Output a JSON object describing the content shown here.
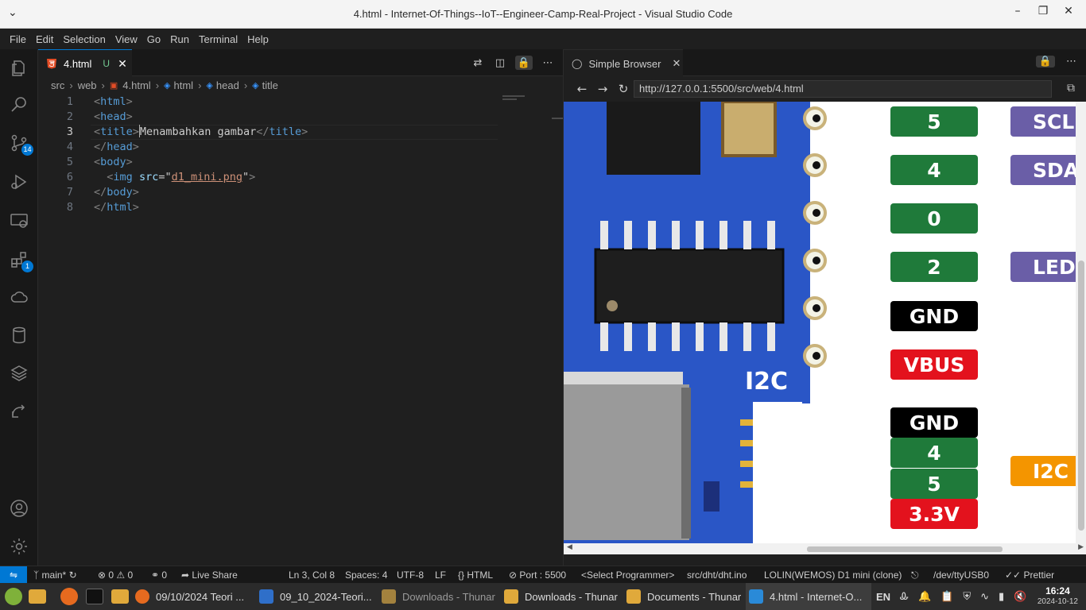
{
  "window": {
    "title": "4.html - Internet-Of-Things--IoT--Engineer-Camp-Real-Project - Visual Studio Code"
  },
  "menu": [
    "File",
    "Edit",
    "Selection",
    "View",
    "Go",
    "Run",
    "Terminal",
    "Help"
  ],
  "activity": {
    "source_control_badge": "14",
    "extensions_badge": "1"
  },
  "editor": {
    "tab": {
      "label": "4.html",
      "status": "U"
    },
    "breadcrumb": [
      "src",
      "web",
      "4.html",
      "html",
      "head",
      "title"
    ],
    "lines": [
      {
        "n": "1",
        "code": "<html>"
      },
      {
        "n": "2",
        "code": "<head>"
      },
      {
        "n": "3",
        "code": "<title>Menambahkan gambar</title>"
      },
      {
        "n": "4",
        "code": "</head>"
      },
      {
        "n": "5",
        "code": "<body>"
      },
      {
        "n": "6",
        "code": "  <img src=\"d1_mini.png\">"
      },
      {
        "n": "7",
        "code": "</body>"
      },
      {
        "n": "8",
        "code": "</html>"
      }
    ]
  },
  "browser": {
    "tab_label": "Simple Browser",
    "url": "http://127.0.0.1:5500/src/web/4.html",
    "pins": [
      "5",
      "4",
      "0",
      "2",
      "GND",
      "VBUS",
      "GND",
      "4",
      "5",
      "3.3V"
    ],
    "functions": [
      "SCL",
      "SDA",
      "LED",
      "I2C"
    ],
    "board_label": "I2C",
    "colors": {
      "pin_green": "#1f7a3a",
      "pin_red": "#e3121d",
      "func_purple": "#6a5ea7",
      "func_orange": "#f49500"
    }
  },
  "status": {
    "branch": "main*",
    "errors": "0",
    "warnings": "0",
    "ports": "0",
    "live_share": "Live Share",
    "position": "Ln 3, Col 8",
    "spaces": "Spaces: 4",
    "encoding": "UTF-8",
    "eol": "LF",
    "language": "HTML",
    "port": "Port : 5500",
    "programmer": "<Select Programmer>",
    "sketch": "src/dht/dht.ino",
    "board": "LOLIN(WEMOS) D1 mini (clone)",
    "serial": "/dev/ttyUSB0",
    "prettier": "Prettier"
  },
  "taskbar": {
    "apps": [
      "09/10/2024 Teori ...",
      "09_10_2024-Teori...",
      "Downloads - Thunar",
      "Downloads - Thunar",
      "Documents - Thunar",
      "4.html - Internet-O..."
    ],
    "lang": "EN",
    "time": "16:24",
    "date": "2024-10-12"
  }
}
